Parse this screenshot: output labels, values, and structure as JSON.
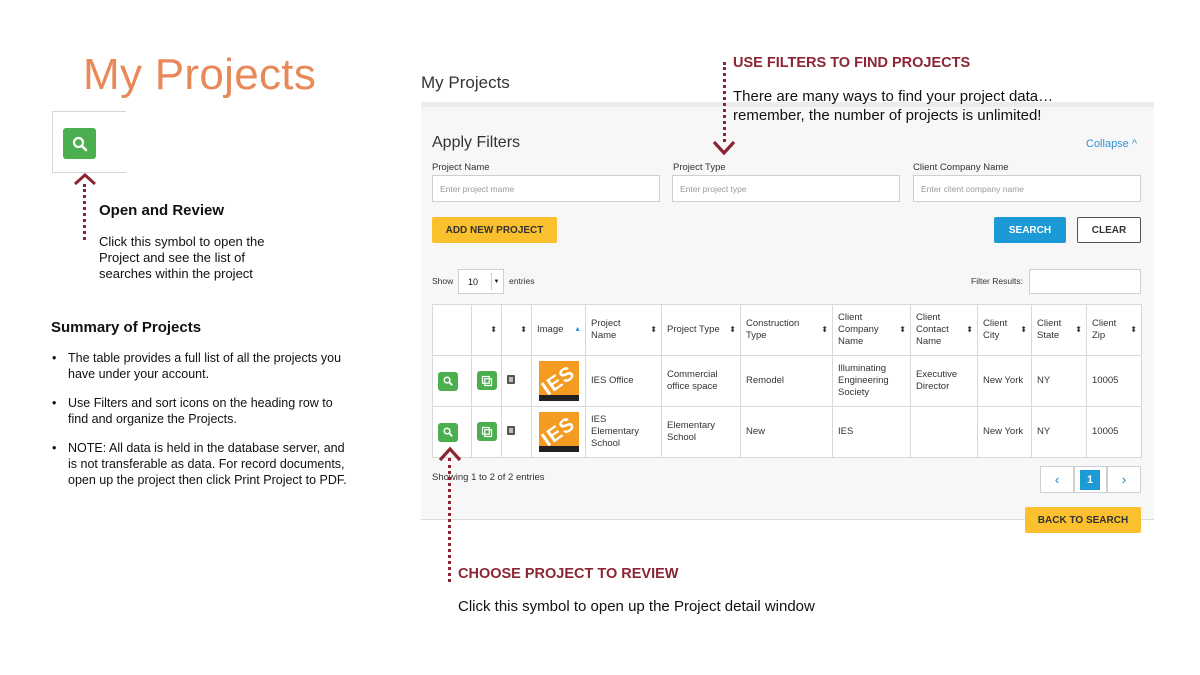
{
  "slide": {
    "title": "My Projects"
  },
  "open_review": {
    "title": "Open and Review",
    "text": "Click this symbol to open the Project and see the list of searches within the project"
  },
  "summary": {
    "title": "Summary of Projects",
    "bullets": [
      "The table provides a full list of all the projects you have under your account.",
      "Use Filters and sort icons on the heading row to find and organize the Projects.",
      "NOTE:  All data is held in the database server, and is not transferable as data.  For record documents, open up the project then click Print Project to PDF."
    ]
  },
  "app": {
    "title": "My Projects",
    "filters": {
      "heading": "Apply Filters",
      "collapse": "Collapse ^",
      "project_name_label": "Project Name",
      "project_name_placeholder": "Enter project mame",
      "project_type_label": "Project Type",
      "project_type_placeholder": "Enter project type",
      "client_company_label": "Client Company Name",
      "client_company_placeholder": "Enter client company name"
    },
    "buttons": {
      "add_new_project": "ADD NEW PROJECT",
      "search": "SEARCH",
      "clear": "CLEAR",
      "back_to_search": "BACK TO SEARCH"
    },
    "table_controls": {
      "show": "Show",
      "entries_value": "10",
      "entries": "entries",
      "filter_results": "Filter Results:"
    },
    "columns": [
      "",
      "",
      "",
      "Image",
      "Project Name",
      "Project Type",
      "Construction Type",
      "Client Company Name",
      "Client Contact Name",
      "Client City",
      "Client State",
      "Client Zip"
    ],
    "rows": [
      {
        "thumb_text": "IES",
        "project_name": "IES Office",
        "project_type": "Commercial office space",
        "construction_type": "Remodel",
        "client_company": "Illuminating Engineering Society",
        "client_contact": "Executive Director",
        "client_city": "New York",
        "client_state": "NY",
        "client_zip": "10005"
      },
      {
        "thumb_text": "IES",
        "project_name": "IES Elementary School",
        "project_type": "Elementary School",
        "construction_type": "New",
        "client_company": "IES",
        "client_contact": "",
        "client_city": "New York",
        "client_state": "NY",
        "client_zip": "10005"
      }
    ],
    "showing": "Showing 1 to 2 of 2 entries",
    "pagination": {
      "prev": "‹",
      "current": "1",
      "next": "›"
    }
  },
  "annotations": {
    "filters_head": "USE FILTERS TO FIND PROJECTS",
    "filters_text": "There are many ways to find your project data… remember, the number of projects is unlimited!",
    "choose_head": "CHOOSE PROJECT TO REVIEW",
    "choose_text": "Click this symbol to open up the Project detail window"
  },
  "colors": {
    "title_orange": "#e8895a",
    "annotation_red": "#8b2533",
    "button_green": "#4bae4f",
    "button_yellow": "#fbc02d",
    "button_blue": "#1c9ad6"
  }
}
